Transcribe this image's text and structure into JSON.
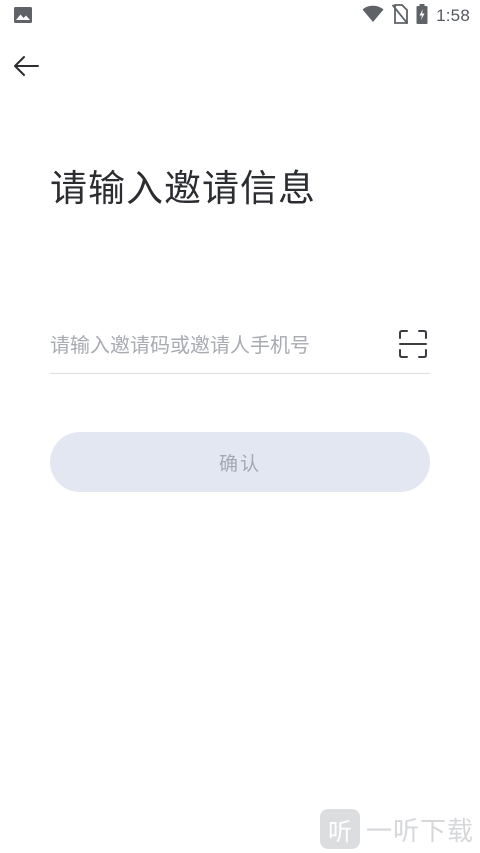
{
  "status_bar": {
    "time": "1:58",
    "icons": [
      "image-icon",
      "wifi-icon",
      "no-sim-icon",
      "battery-charging-icon"
    ]
  },
  "header": {
    "back_icon": "arrow-left-icon"
  },
  "page": {
    "title": "请输入邀请信息"
  },
  "form": {
    "invite_input": {
      "value": "",
      "placeholder": "请输入邀请码或邀请人手机号"
    },
    "scan_icon": "scan-icon",
    "confirm_label": "确认"
  },
  "watermark": {
    "logo_glyph": "听",
    "text": "一听下载"
  },
  "colors": {
    "button_bg": "#e3e7f2",
    "button_text": "#a4a8b4",
    "title_text": "#2b2d31",
    "placeholder": "#a8abb1",
    "divider": "#dcdee3"
  }
}
